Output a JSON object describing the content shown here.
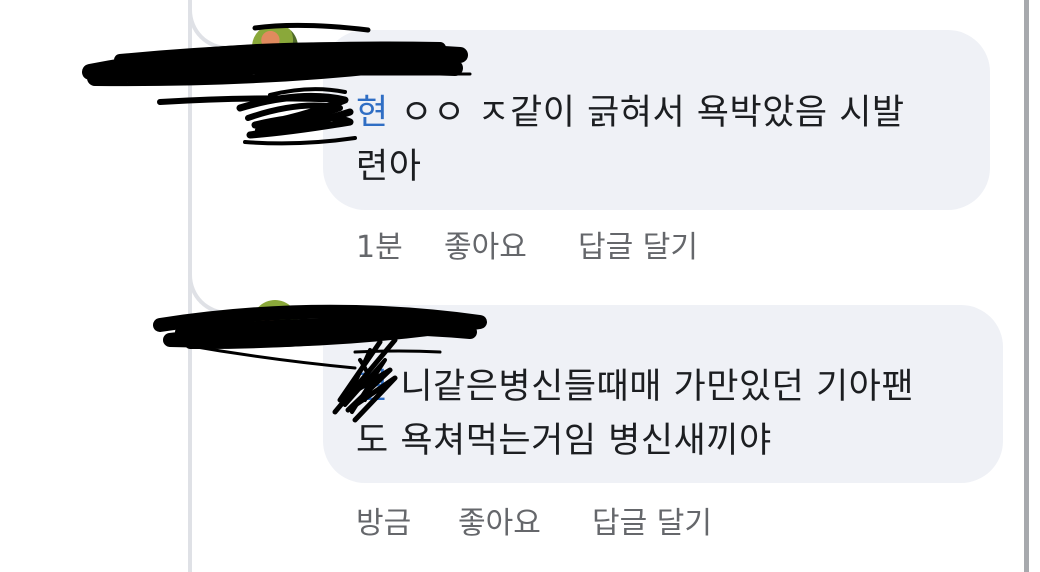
{
  "comments": [
    {
      "mention_visible": "현",
      "text_line1": " ㅇㅇ ㅈ같이 긁혀서 욕박았음 시발",
      "text_line2": "련아",
      "time": "1분",
      "like_label": "좋아요",
      "reply_label": "답글 달기"
    },
    {
      "mention_visible": "현",
      "text_line1": " 니같은병신들때매 가만있던 기아팬",
      "text_line2": "도 욕쳐먹는거임 병신새끼야",
      "time": "방금",
      "like_label": "좋아요",
      "reply_label": "답글 달기"
    }
  ],
  "colors": {
    "bubble": "#eff1f6",
    "mention": "#2f6ec4",
    "meta_text": "#65676b",
    "redaction": "#000000"
  }
}
